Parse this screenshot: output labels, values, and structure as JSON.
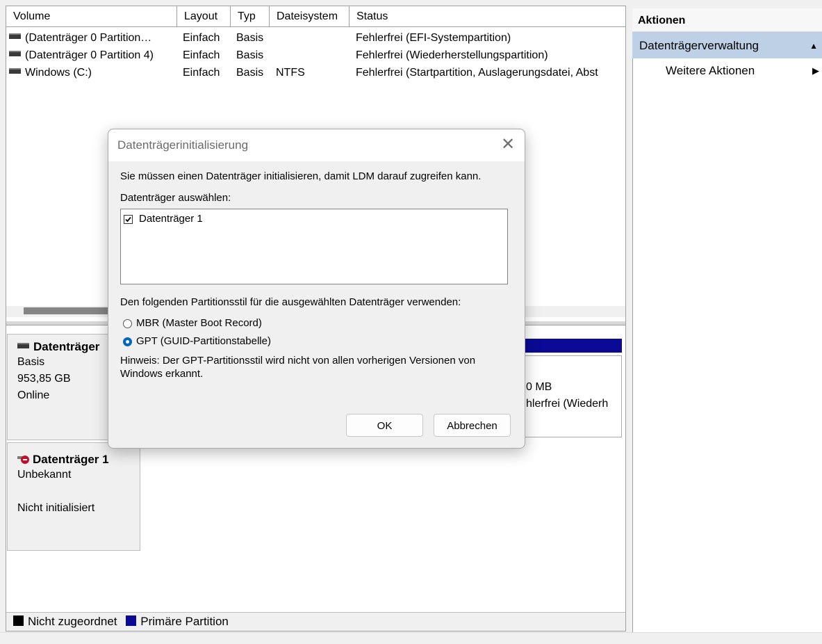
{
  "volume_list": {
    "columns": [
      "Volume",
      "Layout",
      "Typ",
      "Dateisystem",
      "Status"
    ],
    "rows": [
      {
        "volume": "(Datenträger 0 Partition…",
        "layout": "Einfach",
        "typ": "Basis",
        "dateisystem": "",
        "status": "Fehlerfrei (EFI-Systempartition)"
      },
      {
        "volume": "(Datenträger 0 Partition 4)",
        "layout": "Einfach",
        "typ": "Basis",
        "dateisystem": "",
        "status": "Fehlerfrei (Wiederherstellungspartition)"
      },
      {
        "volume": "Windows (C:)",
        "layout": "Einfach",
        "typ": "Basis",
        "dateisystem": "NTFS",
        "status": "Fehlerfrei (Startpartition, Auslagerungsdatei, Abst"
      }
    ]
  },
  "disks": [
    {
      "title": "Datenträger",
      "type": "Basis",
      "size": "953,85 GB",
      "state": "Online",
      "partition_size": "0 MB",
      "partition_status": "hlerfrei (Wiederh"
    },
    {
      "title": "Datenträger 1",
      "type": "Unbekannt",
      "state": "Nicht initialisiert"
    }
  ],
  "legend": {
    "items": [
      {
        "label": "Nicht zugeordnet",
        "color": "#000000"
      },
      {
        "label": "Primäre Partition",
        "color": "#0a0a96"
      }
    ]
  },
  "actions": {
    "title": "Aktionen",
    "section": "Datenträgerverwaltung",
    "more": "Weitere Aktionen"
  },
  "dialog": {
    "title": "Datenträgerinitialisierung",
    "message": "Sie müssen einen Datenträger initialisieren, damit LDM darauf zugreifen kann.",
    "select_label": "Datenträger auswählen:",
    "disk_items": [
      {
        "label": "Datenträger 1",
        "checked": true
      }
    ],
    "partition_style_label": "Den folgenden Partitionsstil für die ausgewählten Datenträger verwenden:",
    "options": [
      {
        "label": "MBR (Master Boot Record)",
        "selected": false
      },
      {
        "label": "GPT (GUID-Partitionstabelle)",
        "selected": true
      }
    ],
    "note_line1": "Hinweis: Der GPT-Partitionsstil wird nicht von allen vorherigen Versionen von",
    "note_line2": "Windows erkannt.",
    "ok_label": "OK",
    "cancel_label": "Abbrechen"
  },
  "colors": {
    "accent": "#0067c0",
    "selection": "#bdd0e6",
    "primary_partition": "#0a0a96"
  }
}
